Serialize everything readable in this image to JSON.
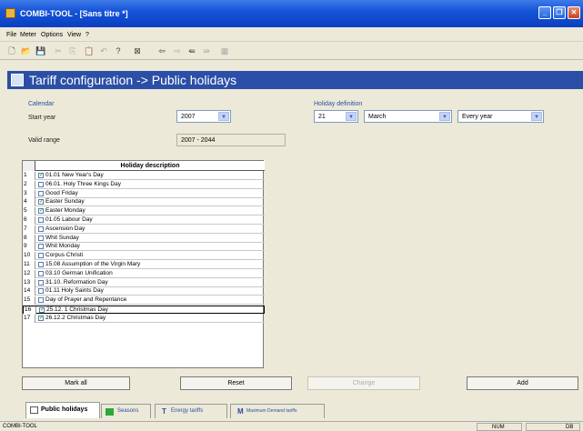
{
  "window": {
    "title": "COMBI-TOOL - [Sans titre *]"
  },
  "menu": [
    "File",
    "Meter",
    "Options",
    "View",
    "?"
  ],
  "banner": {
    "title": "Tariff configuration -> Public holidays"
  },
  "calendar": {
    "group_label": "Calendar",
    "start_year_label": "Start year",
    "start_year_value": "2007",
    "valid_range_label": "Valid range",
    "valid_range_value": "2007 - 2044"
  },
  "holiday_definition": {
    "group_label": "Holiday definition",
    "day": "21",
    "month": "March",
    "recurrence": "Every year"
  },
  "grid": {
    "header": "Holiday description",
    "rows": [
      {
        "n": "1",
        "checked": true,
        "text": "01.01 New Year's Day"
      },
      {
        "n": "2",
        "checked": false,
        "text": "06.01. Holy Three Kings Day"
      },
      {
        "n": "3",
        "checked": false,
        "text": "Good Friday"
      },
      {
        "n": "4",
        "checked": true,
        "text": "Easter Sunday"
      },
      {
        "n": "5",
        "checked": true,
        "text": "Easter Monday"
      },
      {
        "n": "6",
        "checked": false,
        "text": "01.05 Labour Day"
      },
      {
        "n": "7",
        "checked": false,
        "text": "Ascension Day"
      },
      {
        "n": "8",
        "checked": false,
        "text": "Whit Sunday"
      },
      {
        "n": "9",
        "checked": false,
        "text": "Whit Monday"
      },
      {
        "n": "10",
        "checked": false,
        "text": "Corpus Christi"
      },
      {
        "n": "11",
        "checked": false,
        "text": "15.08 Assumption of the Virgin Mary"
      },
      {
        "n": "12",
        "checked": false,
        "text": "03.10 German Unification"
      },
      {
        "n": "13",
        "checked": false,
        "text": "31.10. Reformation Day"
      },
      {
        "n": "14",
        "checked": false,
        "text": "01.11 Holy Saints Day"
      },
      {
        "n": "15",
        "checked": false,
        "text": "Day of Prayer and Repentance"
      },
      {
        "n": "16",
        "checked": true,
        "text": "25.12. 1 Christmas Day"
      },
      {
        "n": "17",
        "checked": true,
        "text": "26.12.2 Christmas Day"
      }
    ]
  },
  "buttons": {
    "mark_all": "Mark all",
    "reset": "Reset",
    "change": "Change",
    "add": "Add"
  },
  "tabs": [
    "Public holidays",
    "Seasons",
    "Energy tariffs",
    "Maximum Demand tariffs"
  ],
  "status": {
    "left": "COMBI-TOOL",
    "num": "NUM",
    "db": "DB"
  },
  "colors": {
    "banner": "#2b4fa7",
    "titlebar": "#1654d9",
    "group_label": "#2a4ea5"
  }
}
